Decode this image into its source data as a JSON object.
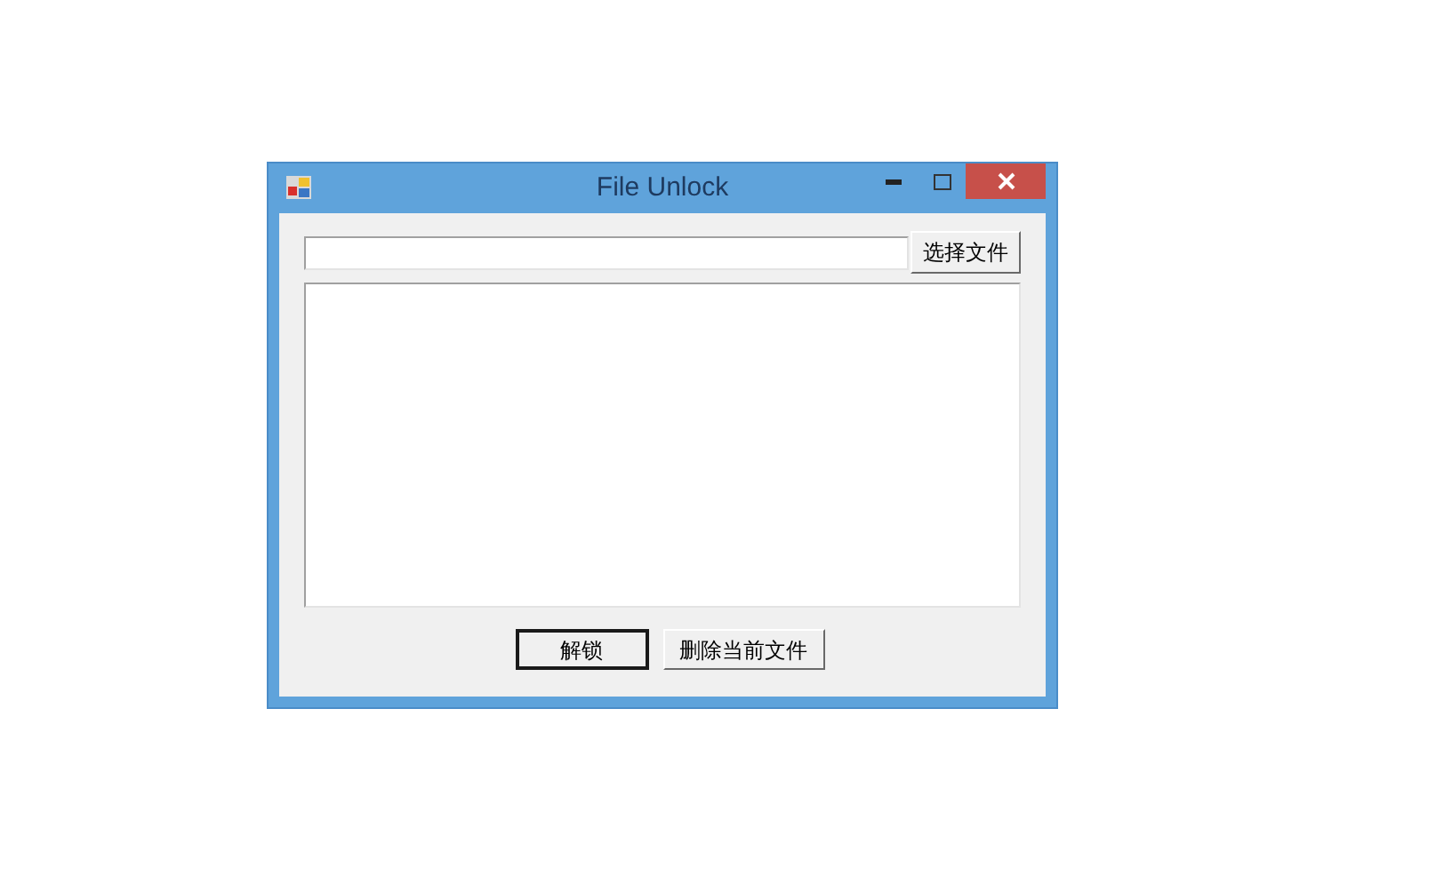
{
  "window": {
    "title": "File Unlock"
  },
  "choose_button": {
    "label": "选择文件"
  },
  "buttons": [
    {
      "label": "解锁",
      "default": true
    },
    {
      "label": "删除当前文件",
      "default": false
    }
  ]
}
